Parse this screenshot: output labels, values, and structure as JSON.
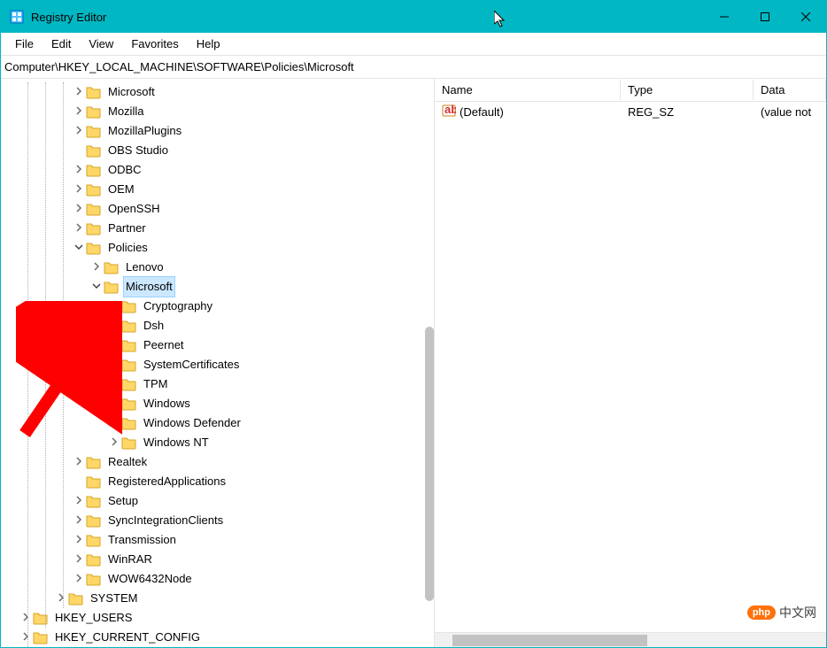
{
  "titlebar": {
    "title": "Registry Editor"
  },
  "menubar": {
    "items": [
      "File",
      "Edit",
      "View",
      "Favorites",
      "Help"
    ]
  },
  "addressbar": {
    "path": "Computer\\HKEY_LOCAL_MACHINE\\SOFTWARE\\Policies\\Microsoft"
  },
  "tree": [
    {
      "depth": 4,
      "exp": "closed",
      "label": "Microsoft"
    },
    {
      "depth": 4,
      "exp": "closed",
      "label": "Mozilla"
    },
    {
      "depth": 4,
      "exp": "closed",
      "label": "MozillaPlugins"
    },
    {
      "depth": 4,
      "exp": "none",
      "label": "OBS Studio"
    },
    {
      "depth": 4,
      "exp": "closed",
      "label": "ODBC"
    },
    {
      "depth": 4,
      "exp": "closed",
      "label": "OEM"
    },
    {
      "depth": 4,
      "exp": "closed",
      "label": "OpenSSH"
    },
    {
      "depth": 4,
      "exp": "closed",
      "label": "Partner"
    },
    {
      "depth": 4,
      "exp": "open",
      "label": "Policies"
    },
    {
      "depth": 5,
      "exp": "closed",
      "label": "Lenovo"
    },
    {
      "depth": 5,
      "exp": "open",
      "label": "Microsoft",
      "selected": true
    },
    {
      "depth": 6,
      "exp": "closed",
      "label": "Cryptography"
    },
    {
      "depth": 6,
      "exp": "none",
      "label": "Dsh"
    },
    {
      "depth": 6,
      "exp": "none",
      "label": "Peernet"
    },
    {
      "depth": 6,
      "exp": "closed",
      "label": "SystemCertificates"
    },
    {
      "depth": 6,
      "exp": "none",
      "label": "TPM"
    },
    {
      "depth": 6,
      "exp": "closed",
      "label": "Windows"
    },
    {
      "depth": 6,
      "exp": "closed",
      "label": "Windows Defender"
    },
    {
      "depth": 6,
      "exp": "closed",
      "label": "Windows NT"
    },
    {
      "depth": 4,
      "exp": "closed",
      "label": "Realtek"
    },
    {
      "depth": 4,
      "exp": "none",
      "label": "RegisteredApplications"
    },
    {
      "depth": 4,
      "exp": "closed",
      "label": "Setup"
    },
    {
      "depth": 4,
      "exp": "closed",
      "label": "SyncIntegrationClients"
    },
    {
      "depth": 4,
      "exp": "closed",
      "label": "Transmission"
    },
    {
      "depth": 4,
      "exp": "closed",
      "label": "WinRAR"
    },
    {
      "depth": 4,
      "exp": "closed",
      "label": "WOW6432Node"
    },
    {
      "depth": 3,
      "exp": "closed",
      "label": "SYSTEM"
    },
    {
      "depth": 1,
      "exp": "closed",
      "label": "HKEY_USERS"
    },
    {
      "depth": 1,
      "exp": "closed",
      "label": "HKEY_CURRENT_CONFIG"
    }
  ],
  "list": {
    "columns": {
      "name": "Name",
      "type": "Type",
      "data": "Data"
    },
    "rows": [
      {
        "name": "(Default)",
        "type": "REG_SZ",
        "data": "(value not"
      }
    ]
  },
  "watermark": {
    "pill": "php",
    "text": "中文网"
  }
}
